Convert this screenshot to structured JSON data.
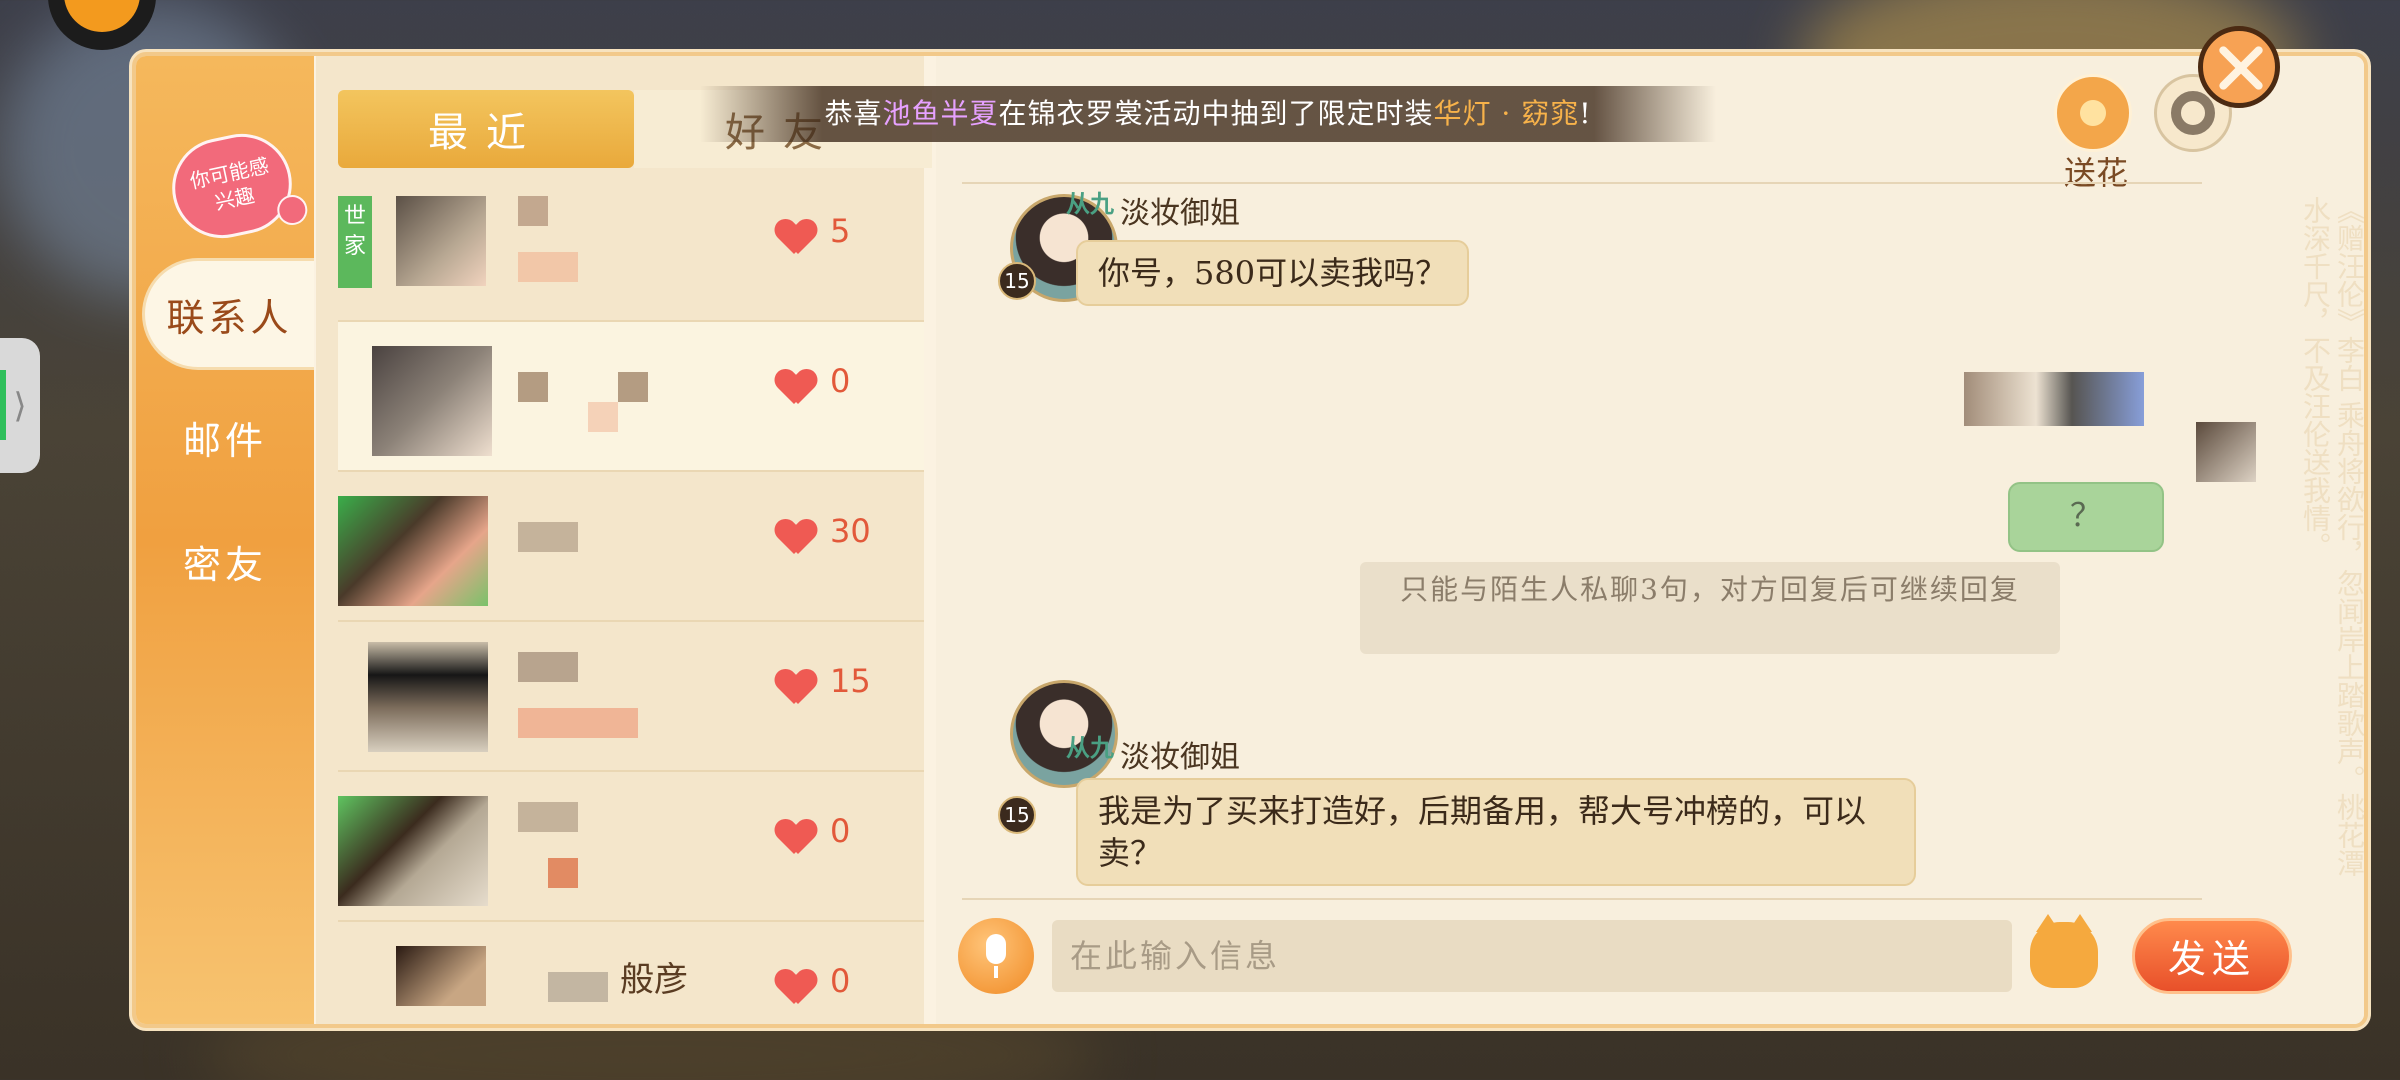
{
  "announcement": {
    "prefix": "恭喜",
    "player": "池鱼半夏",
    "middle": "在锦衣罗裳活动中抽到了限定时装",
    "item": "华灯 · 窈窕",
    "suffix": "!"
  },
  "sidebar": {
    "badge": "你可能感兴趣",
    "items": [
      {
        "label": "联系人",
        "active": true
      },
      {
        "label": "邮件",
        "active": false
      },
      {
        "label": "密友",
        "active": false
      }
    ]
  },
  "tabs": [
    {
      "label": "最近",
      "active": true
    },
    {
      "label": "好友",
      "active": false
    }
  ],
  "contacts": [
    {
      "tag": "世家",
      "name": "",
      "hearts": "5"
    },
    {
      "tag": "",
      "name": "",
      "hearts": "0"
    },
    {
      "tag": "",
      "name": "",
      "hearts": "30"
    },
    {
      "tag": "",
      "name": "",
      "hearts": "15"
    },
    {
      "tag": "",
      "name": "",
      "hearts": "0"
    },
    {
      "tag": "",
      "name": "般彦",
      "hearts": "0"
    }
  ],
  "chat": {
    "messages": [
      {
        "sender": "淡妆御姐",
        "rank": "从九",
        "level": "15",
        "text": "你号，580可以卖我吗？"
      },
      {
        "sender": "",
        "level": "",
        "text": "？",
        "me": true
      },
      {
        "sender": "淡妆御姐",
        "rank": "从九",
        "level": "15",
        "text": "我是为了买来打造好，后期备用，帮大号冲榜的，可以卖？"
      }
    ],
    "notice": "只能与陌生人私聊3句，对方回复后可继续回复",
    "input_placeholder": "在此输入信息",
    "send_label": "发送",
    "flower_label": "送花",
    "poem": "《赠汪伦》李白 乘舟将欲行，忽闻岸上踏歌声。桃花潭水深千尺，不及汪伦送我情。"
  },
  "colors": {
    "accent_orange": "#f08a24",
    "heart": "#ef5a53",
    "my_bubble": "#a9d49a"
  }
}
